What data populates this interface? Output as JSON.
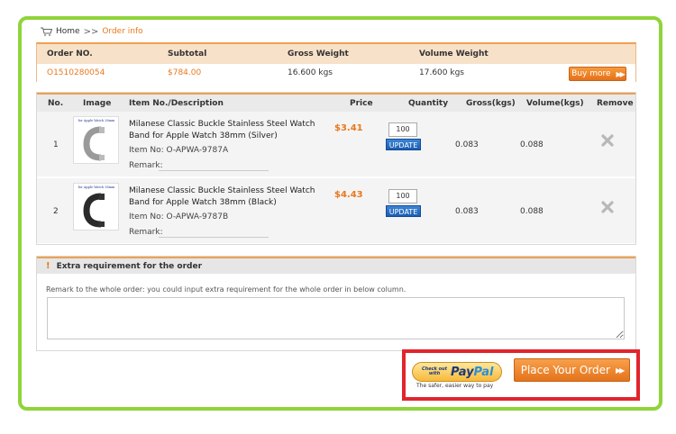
{
  "breadcrumb": {
    "home": "Home",
    "separator": ">>",
    "current": "Order info"
  },
  "summary": {
    "headers": [
      "Order NO.",
      "Subtotal",
      "Gross Weight",
      "Volume Weight"
    ],
    "order_no": "O1510280054",
    "subtotal": "$784.00",
    "gross_weight": "16.600 kgs",
    "volume_weight": "17.600 kgs",
    "buy_more_label": "Buy more"
  },
  "table": {
    "headers": [
      "No.",
      "Image",
      "Item No./Description",
      "Price",
      "Quantity",
      "Gross(kgs)",
      "Volume(kgs)",
      "Remove"
    ],
    "rows": [
      {
        "no": "1",
        "image_caption": "for Apple Watch 38mm",
        "description": "Milanese Classic Buckle Stainless Steel Watch Band for Apple Watch 38mm (Silver)",
        "item_no": "Item No: O-APWA-9787A",
        "remark_label": "Remark:",
        "price": "$3.41",
        "quantity": "100",
        "update_label": "UPDATE",
        "gross": "0.083",
        "volume": "0.088",
        "band_color": "#9a9a9a"
      },
      {
        "no": "2",
        "image_caption": "for Apple Watch 38mm",
        "description": "Milanese Classic Buckle Stainless Steel Watch Band for Apple Watch 38mm (Black)",
        "item_no": "Item No: O-APWA-9787B",
        "remark_label": "Remark:",
        "price": "$4.43",
        "quantity": "100",
        "update_label": "UPDATE",
        "gross": "0.083",
        "volume": "0.088",
        "band_color": "#2a2a2a"
      }
    ]
  },
  "extra": {
    "title": "Extra requirement for the order",
    "hint": "Remark to the whole order: you could input extra requirement for the whole order in below column."
  },
  "checkout": {
    "paypal_small": "Check out with",
    "paypal_logo_1": "Pay",
    "paypal_logo_2": "Pal",
    "paypal_tagline": "The safer, easier way to pay",
    "place_order_label": "Place Your Order"
  },
  "colors": {
    "accent": "#e8791f",
    "frame": "#8fd43a",
    "highlight": "#e2242d"
  }
}
